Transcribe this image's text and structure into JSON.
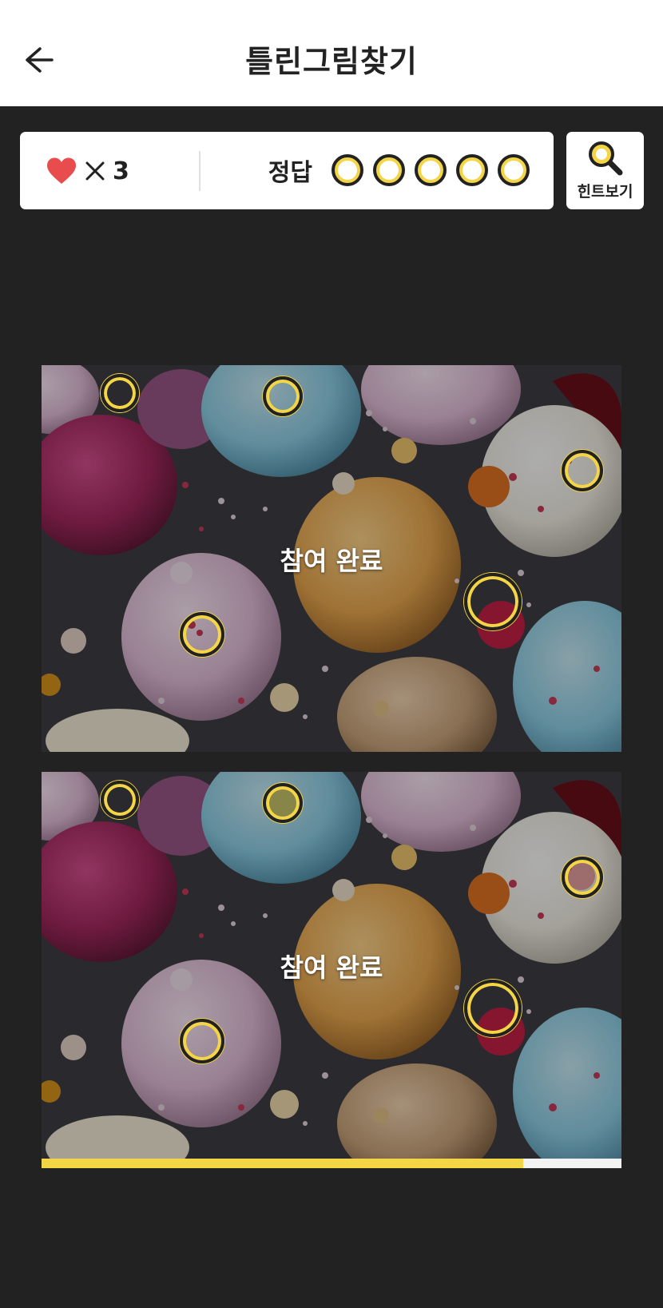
{
  "header": {
    "title": "틀린그림찾기",
    "back_icon": "arrow-left-icon"
  },
  "status": {
    "lives_icon": "heart-icon",
    "lives_multiplier": "×",
    "lives_count": "3",
    "answers_label": "정답",
    "answers_total": 5,
    "answers_found": 0
  },
  "hint": {
    "label": "힌트보기",
    "icon": "magnifier-icon"
  },
  "puzzle": {
    "overlay_text": "참여 완료"
  },
  "progress": {
    "fraction": 0.83
  },
  "colors": {
    "accent": "#f4d545",
    "heart": "#e84c4c",
    "background": "#222222"
  }
}
